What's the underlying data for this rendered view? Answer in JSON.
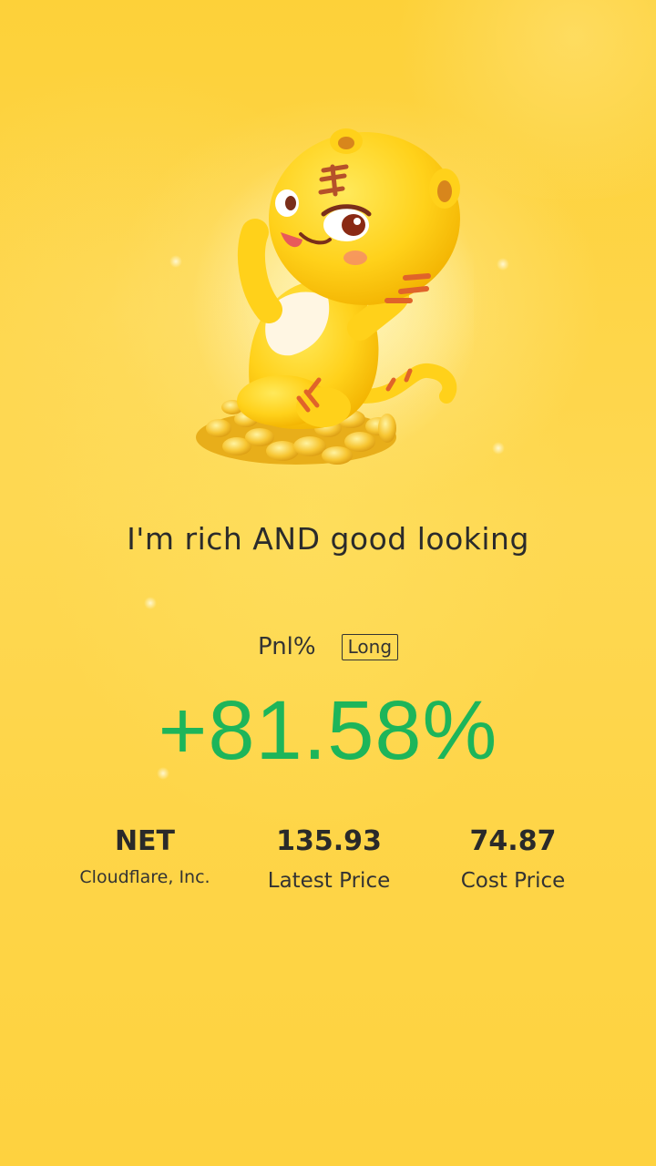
{
  "card": {
    "slogan": "I'm rich AND good looking"
  },
  "pnl": {
    "label": "Pnl%",
    "position_type": "Long",
    "value": "+81.58%",
    "value_color": "#1db55a"
  },
  "stats": {
    "symbol": "NET",
    "company": "Cloudflare, Inc.",
    "latest_price_value": "135.93",
    "latest_price_label": "Latest Price",
    "cost_price_value": "74.87",
    "cost_price_label": "Cost Price"
  },
  "icons": {
    "mascot": "tiger-mascot-on-gold-coins"
  }
}
